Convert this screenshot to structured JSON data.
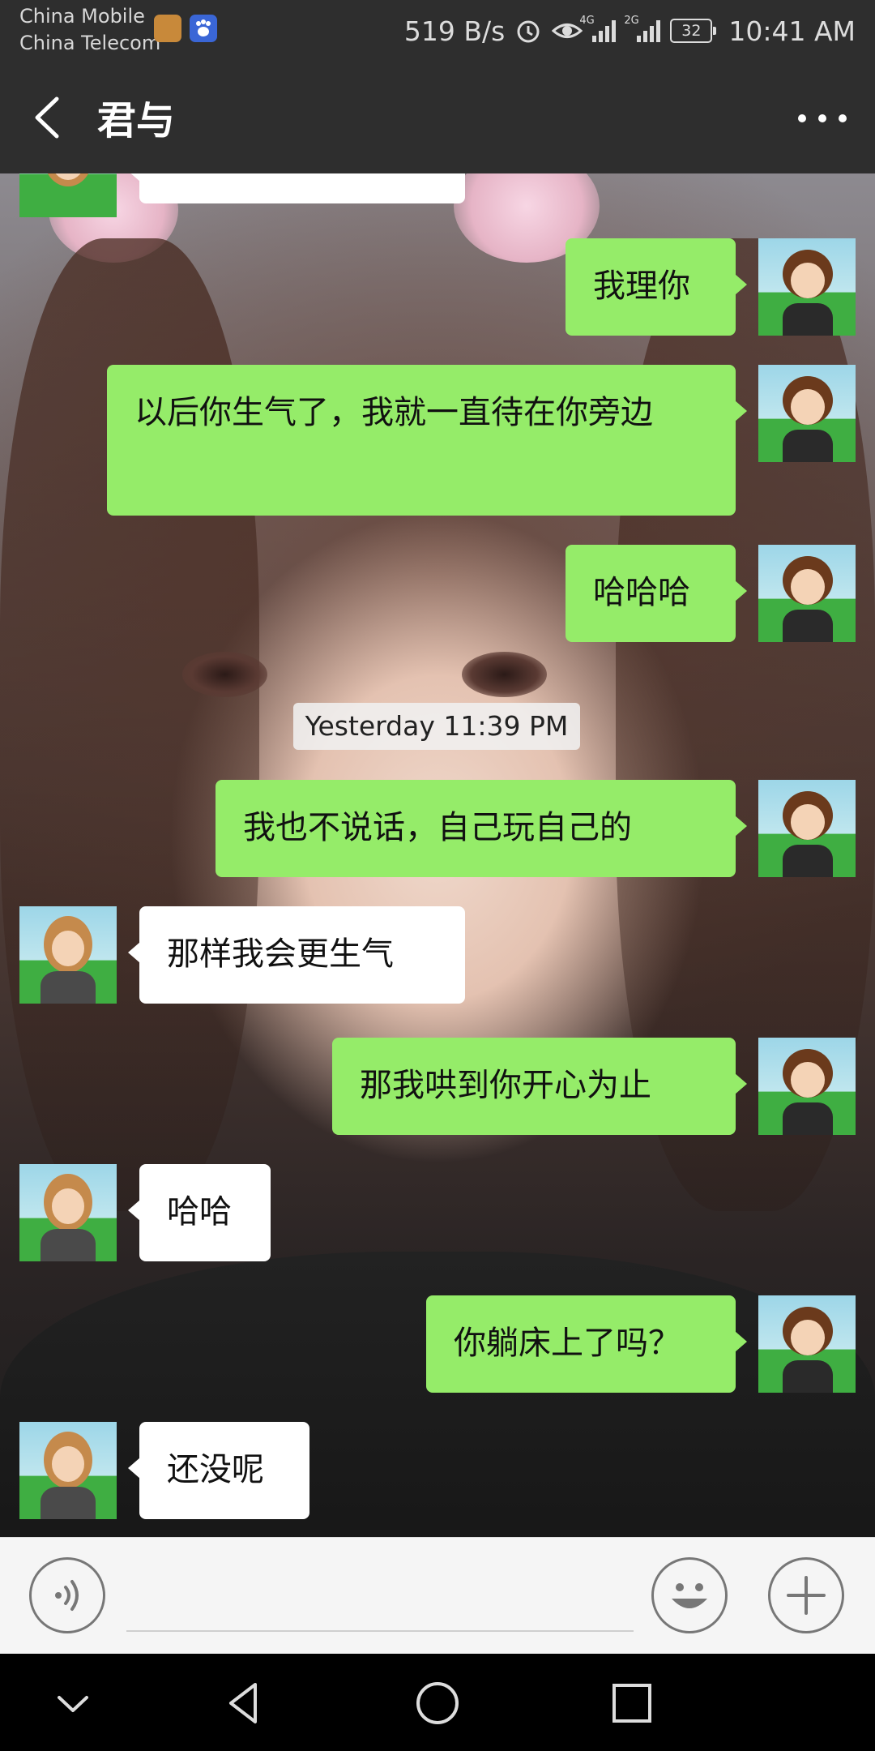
{
  "status_bar": {
    "carrier_1": "China Mobile",
    "carrier_2": "China Telecom",
    "net_speed": "519 B/s",
    "network_1": "4G",
    "network_2": "2G",
    "battery": "32",
    "time": "10:41 AM"
  },
  "header": {
    "title": "君与",
    "back_icon": "chevron-left-icon",
    "more_icon": "more-horizontal-icon"
  },
  "chat": {
    "timestamp": "Yesterday 11:39 PM",
    "messages": [
      {
        "sender": "them",
        "text": ""
      },
      {
        "sender": "me",
        "text": "我理你"
      },
      {
        "sender": "me",
        "text": "以后你生气了，我就一直待在你旁边"
      },
      {
        "sender": "me",
        "text": "哈哈哈"
      },
      {
        "sender": "me",
        "text": "我也不说话，自己玩自己的"
      },
      {
        "sender": "them",
        "text": "那样我会更生气"
      },
      {
        "sender": "me",
        "text": "那我哄到你开心为止"
      },
      {
        "sender": "them",
        "text": "哈哈"
      },
      {
        "sender": "me",
        "text": "你躺床上了吗？"
      },
      {
        "sender": "them",
        "text": "还没呢"
      }
    ]
  },
  "input_bar": {
    "voice_icon": "voice-icon",
    "emoji_icon": "emoji-icon",
    "plus_icon": "plus-icon",
    "input_value": ""
  },
  "nav_bar": {
    "icons": [
      "chevron-down-icon",
      "back-triangle-icon",
      "home-circle-icon",
      "recents-square-icon"
    ]
  },
  "colors": {
    "header_bg": "#2e2e2e",
    "my_bubble": "#95ec69",
    "their_bubble": "#ffffff",
    "input_bg": "#f5f5f5"
  }
}
